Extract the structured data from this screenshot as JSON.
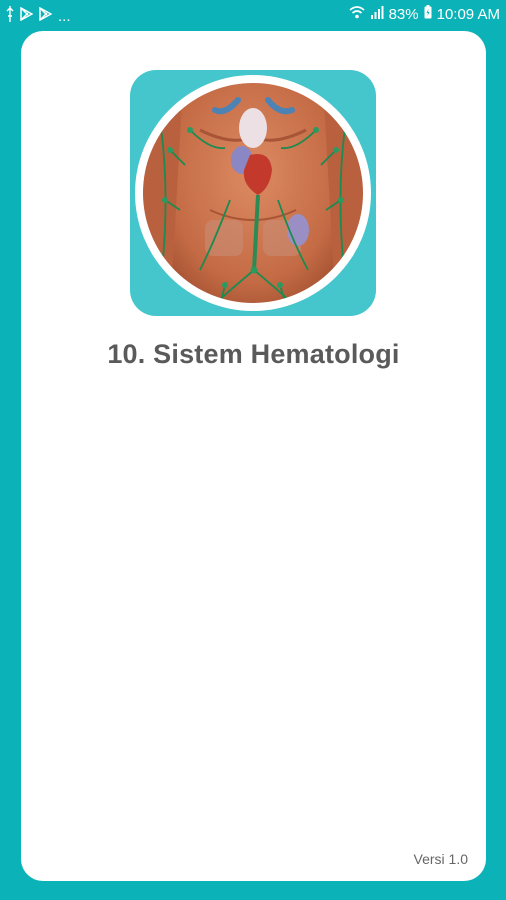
{
  "status_bar": {
    "battery": "83%",
    "time": "10:09 AM",
    "overflow": "...",
    "icons": [
      "usb-icon",
      "play-store-icon",
      "play-store-icon",
      "wifi-icon",
      "signal-icon",
      "battery-icon"
    ]
  },
  "splash": {
    "logo_icon": "circulatory-system-anatomy-icon",
    "title": "10. Sistem Hematologi",
    "version": "Versi 1.0"
  },
  "colors": {
    "background": "#0bb3b9",
    "card": "#ffffff",
    "logo_tile": "#45c6cc",
    "title_text": "#5a5a5a"
  }
}
